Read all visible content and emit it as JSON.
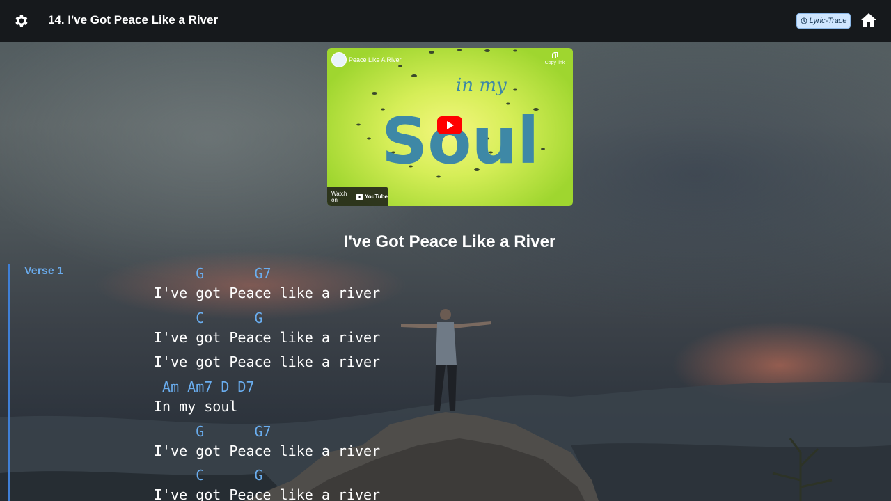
{
  "header": {
    "title": "14. I've Got Peace Like a River",
    "lyric_trace_label": "Lyric-Trace"
  },
  "video": {
    "title": "Peace Like A River",
    "copy_link": "Copy link",
    "watch_on": "Watch on",
    "youtube": "YouTube",
    "artwork_text_1": "in my",
    "artwork_text_2": "Soul"
  },
  "song": {
    "title": "I've Got Peace Like a River",
    "verse_label": "Verse 1",
    "lines": [
      {
        "type": "chord",
        "text": "     G      G7"
      },
      {
        "type": "lyric",
        "text": "I've got Peace like a river"
      },
      {
        "type": "chord",
        "text": "     C      G"
      },
      {
        "type": "lyric",
        "text": "I've got Peace like a river"
      },
      {
        "type": "lyric",
        "text": "I've got Peace like a river"
      },
      {
        "type": "chord",
        "text": " Am Am7 D D7"
      },
      {
        "type": "lyric",
        "text": "In my soul"
      },
      {
        "type": "chord",
        "text": "     G      G7"
      },
      {
        "type": "lyric",
        "text": "I've got Peace like a river"
      },
      {
        "type": "chord",
        "text": "     C      G"
      },
      {
        "type": "lyric",
        "text": "I've got Peace like a river"
      }
    ]
  },
  "colors": {
    "topbar": "#16191c",
    "chord": "#6aaef0",
    "verse_accent": "#3f7fd6",
    "lyric_trace_bg": "#cfe6ff",
    "video_bg": "#d6ee58"
  },
  "icons": {
    "settings": "gear-icon",
    "home": "home-icon",
    "lyric_trace": "lyric-trace-icon",
    "play": "youtube-play-icon",
    "copy": "copy-icon"
  }
}
